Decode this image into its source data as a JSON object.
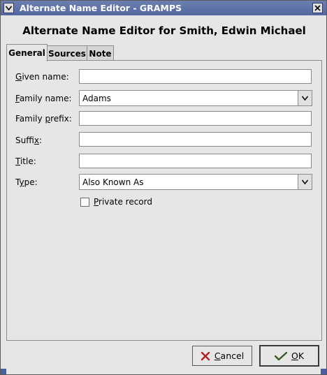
{
  "window": {
    "title": "Alternate Name Editor - GRAMPS"
  },
  "heading": "Alternate Name Editor for Smith, Edwin Michael",
  "tabs": [
    {
      "label": "General",
      "active": true
    },
    {
      "label": "Sources",
      "active": false
    },
    {
      "label": "Note",
      "active": false
    }
  ],
  "form": {
    "given_name": {
      "mnemonic": "G",
      "rest": "iven name:",
      "value": ""
    },
    "family_name": {
      "mnemonic": "F",
      "rest": "amily name:",
      "value": "Adams"
    },
    "family_prefix": {
      "pre": "Family ",
      "mnemonic": "p",
      "rest": "refix:",
      "value": ""
    },
    "suffix": {
      "pre": "Suffi",
      "mnemonic": "x",
      "rest": ":",
      "value": ""
    },
    "title": {
      "mnemonic": "T",
      "rest": "itle:",
      "value": ""
    },
    "type": {
      "pre": "T",
      "mnemonic": "y",
      "rest": "pe:",
      "value": "Also Known As"
    },
    "private": {
      "mnemonic": "P",
      "rest": "rivate record",
      "checked": false
    }
  },
  "buttons": {
    "cancel": {
      "mnemonic": "C",
      "rest": "ancel"
    },
    "ok": {
      "mnemonic": "O",
      "rest": "K"
    }
  },
  "icons": {
    "window_menu": "chevron-down-icon",
    "window_close": "close-icon",
    "cancel": "cancel-x-icon",
    "ok": "ok-check-icon"
  },
  "colors": {
    "titlebar": "#5e72a8",
    "window_bg": "#e6e6e6"
  }
}
